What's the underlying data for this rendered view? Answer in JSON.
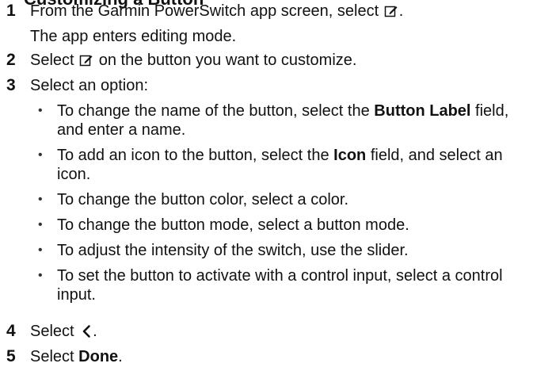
{
  "heading_partial": "Customizing a Button",
  "steps": [
    {
      "num": "1",
      "text_a": "From the Garmin PowerSwitch app screen, select ",
      "text_b": ".",
      "result": "The app enters editing mode.",
      "icon": "edit-icon"
    },
    {
      "num": "2",
      "text_a": "Select ",
      "text_b": " on the button you want to customize.",
      "icon": "edit-icon"
    },
    {
      "num": "3",
      "text": "Select an option:"
    },
    {
      "num": "4",
      "text_a": "Select ",
      "text_b": ".",
      "icon": "chevron-left-icon"
    },
    {
      "num": "5",
      "text_a": "Select ",
      "bold": "Done",
      "text_b": "."
    }
  ],
  "options": [
    {
      "pre": "To change the name of the button, select the ",
      "bold": "Button Label",
      "post": " field, and enter a name."
    },
    {
      "pre": "To add an icon to the button, select the ",
      "bold": "Icon",
      "post": " field, and select an icon."
    },
    {
      "text": "To change the button color, select a color."
    },
    {
      "text": "To change the button mode, select a button mode."
    },
    {
      "text": "To adjust the intensity of the switch, use the slider."
    },
    {
      "text": "To set the button to activate with a control input, select a control input."
    }
  ],
  "bullet_char": "•"
}
